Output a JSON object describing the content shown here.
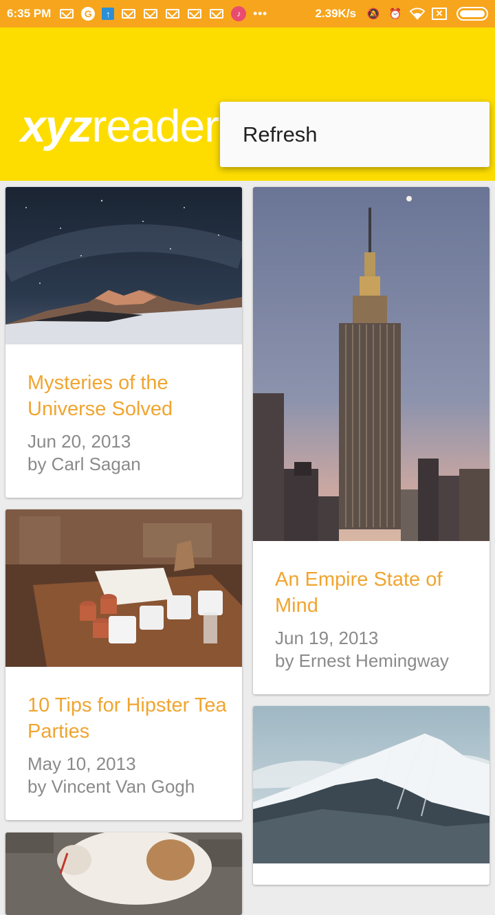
{
  "status_bar": {
    "time": "6:35 PM",
    "network_speed": "2.39K/s",
    "icons": [
      "gmail-icon",
      "google-icon",
      "upload-icon",
      "gmail-icon",
      "gmail-icon",
      "gmail-icon",
      "gmail-icon",
      "gmail-icon",
      "music-icon",
      "more-dots-icon",
      "mute-icon",
      "alarm-icon",
      "wifi-icon",
      "sim-icon",
      "battery-icon"
    ]
  },
  "app_bar": {
    "logo_bold": "xyz",
    "logo_thin": "reader",
    "background": "#fddd00"
  },
  "menu": {
    "items": [
      {
        "label": "Refresh"
      }
    ]
  },
  "articles": [
    {
      "title": "Mysteries of the Universe Solved",
      "date": "Jun 20, 2013",
      "author": "by Carl Sagan"
    },
    {
      "title": "An Empire State of Mind",
      "date": "Jun 19, 2013",
      "author": "by Ernest Hemingway"
    },
    {
      "title": "10 Tips for Hipster Tea Parties",
      "date": "May 10, 2013",
      "author": "by Vincent Van Gogh"
    },
    {
      "title": "",
      "date": "",
      "author": ""
    },
    {
      "title": "",
      "date": "",
      "author": ""
    }
  ],
  "colors": {
    "accent_title": "#f0a530",
    "status_bar": "#f7a51c",
    "meta_text": "#8a8a8a"
  }
}
